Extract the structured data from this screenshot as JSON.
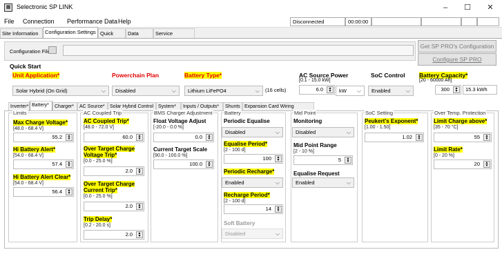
{
  "window": {
    "title": "Selectronic SP LINK",
    "icon": "app-icon",
    "min": "–",
    "max": "☐",
    "close": "✕"
  },
  "menu": {
    "file": "File",
    "connection": "Connection",
    "performance": "Performance Data",
    "help": "Help"
  },
  "status": {
    "connection": "Disconnected",
    "timer": "00:00:00"
  },
  "main_tabs": [
    "Site Information",
    "Configuration Settings",
    "Quick View",
    "Data View",
    "Service Settings"
  ],
  "config": {
    "file_label": "Configuration File",
    "get_button": "Get SP PRO's Configuration",
    "configure_button": "Configure SP PRO"
  },
  "quick_start": {
    "title": "Quick Start",
    "unit_app_label": "Unit Application*",
    "unit_app_value": "Solar Hybrid (On Grid)",
    "powerchain_label": "Powerchain Plan",
    "powerchain_value": "Disabled",
    "battery_type_label": "Battery Type*",
    "battery_type_value": "Lithium LiFePO4",
    "cells": "(16 cells)",
    "ac_source_label": "AC Source Power",
    "ac_source_range": "[0.1 - 15.0 kW]",
    "ac_source_value": "6.0",
    "ac_source_unit": "kW",
    "soc_label": "SoC Control",
    "soc_value": "Enabled",
    "capacity_label": "Battery Capacity*",
    "capacity_range": "[20 - 60000 Ah]",
    "capacity_value": "300",
    "capacity_kwh": "15.3 kWh"
  },
  "sub_tabs": [
    "Inverter*",
    "Battery*",
    "Charger*",
    "AC Source*",
    "Solar Hybrid Control",
    "System*",
    "Inputs / Outputs*",
    "Shunts",
    "Expansion Card Wiring Diagram"
  ],
  "groups": {
    "limits": {
      "title": "Limits",
      "max_charge_label": "Max Charge Voltage*",
      "max_charge_range": "[48.0 - 68.4 V]",
      "max_charge_value": "55.2",
      "hi_alert_label": "Hi Battery Alert*",
      "hi_alert_range": "[54.0 - 68.4 V]",
      "hi_alert_value": "57.4",
      "hi_clear_label": "Hi Battery Alert Clear*",
      "hi_clear_range": "[54.0 - 68.4 V]",
      "hi_clear_value": "56.4"
    },
    "ac_coupled": {
      "title": "AC Coupled Trip",
      "trip_label": "AC Coupled Trip*",
      "trip_range": "[48.0 - 72.0 V]",
      "trip_value": "60.0",
      "otcv_label": "Over Target Charge Voltage Trip*",
      "otcv_range": "[0.0 - 25.0 %]",
      "otcv_value": "2.0",
      "otcc_label": "Over Target Charge Current Trip*",
      "otcc_range": "[0.0 - 25.0 %]",
      "otcc_value": "2.0",
      "delay_label": "Trip Delay*",
      "delay_range": "[0.2 - 20.0 s]",
      "delay_value": "2.0"
    },
    "bms": {
      "title": "BMS Charger Adjustment",
      "float_label": "Float Voltage Adjust",
      "float_range": "[-20.0 - 0.0 %]",
      "float_value": "0.0",
      "current_label": "Current Target Scale",
      "current_range": "[90.0 - 100.0 %]",
      "current_value": "100.0"
    },
    "battery": {
      "title": "Battery",
      "pe_label": "Periodic Equalise",
      "pe_value": "Disabled",
      "ep_label": "Equalise Period*",
      "ep_range": "[2 - 100 d]",
      "ep_value": "100",
      "pr_label": "Periodic Recharge*",
      "pr_value": "Enabled",
      "rp_label": "Recharge Period*",
      "rp_range": "[2 - 100 d]",
      "rp_value": "14",
      "sb_label": "Soft Battery",
      "sb_value": "Disabled"
    },
    "midpoint": {
      "title": "Mid Point",
      "mon_label": "Monitoring",
      "mon_value": "Disabled",
      "range_label": "Mid Point Range",
      "range_range": "[2 - 10 %]",
      "range_value": "5",
      "eq_label": "Equalise Request",
      "eq_value": "Enabled"
    },
    "soc": {
      "title": "SoC Setting",
      "pk_label": "Peukert's Exponent*",
      "pk_range": "[1.00 - 1.50]",
      "pk_value": "1.02"
    },
    "overtemp": {
      "title": "Over Temp. Protection",
      "lca_label": "Limit Charge above*",
      "lca_range": "[35 - 70 °C]",
      "lca_value": "55",
      "lr_label": "Limit Rate*",
      "lr_range": "[0 - 20 %]",
      "lr_value": "20"
    }
  }
}
